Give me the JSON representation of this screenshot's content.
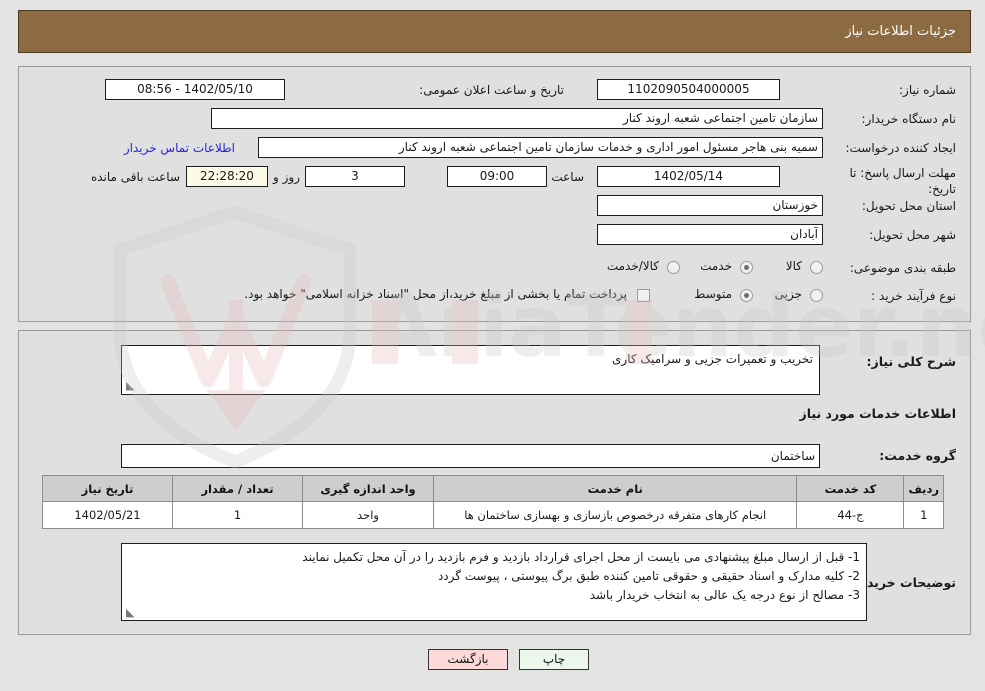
{
  "header": {
    "title": "جزئیات اطلاعات نیاز"
  },
  "form": {
    "need_number_label": "شماره نیاز:",
    "need_number_value": "1102090504000005",
    "announce_label": "تاریخ و ساعت اعلان عمومی:",
    "announce_value": "1402/05/10 - 08:56",
    "buyer_org_label": "نام دستگاه خریدار:",
    "buyer_org_value": "سازمان تامین اجتماعی شعبه اروند کنار",
    "requester_label": "ایجاد کننده درخواست:",
    "requester_value": "سمیه بنی هاجر مسئول امور اداری و خدمات سازمان تامین اجتماعی شعبه اروند کنار",
    "contact_link": "اطلاعات تماس خریدار",
    "deadline_label": "مهلت ارسال پاسخ: تا تاریخ:",
    "deadline_date": "1402/05/14",
    "time_label": "ساعت",
    "time_value": "09:00",
    "days_value": "3",
    "days_unit_label": "روز و",
    "countdown_value": "22:28:20",
    "remaining_label": "ساعت باقی مانده",
    "province_label": "استان محل تحویل:",
    "province_value": "خوزستان",
    "city_label": "شهر محل تحویل:",
    "city_value": "آبادان",
    "category_label": "طبقه بندی موضوعی:",
    "category_options": [
      {
        "label": "کالا",
        "selected": false
      },
      {
        "label": "خدمت",
        "selected": true
      },
      {
        "label": "کالا/خدمت",
        "selected": false
      }
    ],
    "process_label": "نوع فرآیند خرید :",
    "process_options": [
      {
        "label": "جزیی",
        "selected": false
      },
      {
        "label": "متوسط",
        "selected": true
      }
    ],
    "treasury_checkbox_text": "پرداخت تمام یا بخشی از مبلغ خرید،از محل \"اسناد خزانه اسلامی\" خواهد بود.",
    "treasury_checked": false
  },
  "description": {
    "label": "شرح کلی نیاز:",
    "value": "تخریب و تعمیرات جزیی و سرامیک کاری"
  },
  "services_section": {
    "title": "اطلاعات خدمات مورد نیاز",
    "group_label": "گروه خدمت:",
    "group_value": "ساختمان"
  },
  "table": {
    "headers": [
      "ردیف",
      "کد خدمت",
      "نام خدمت",
      "واحد اندازه گیری",
      "تعداد / مقدار",
      "تاریخ نیاز"
    ],
    "rows": [
      {
        "row": "1",
        "code": "ج-44",
        "name": "انجام کارهای متفرقه درخصوص بازسازی و بهسازی ساختمان ها",
        "unit": "واحد",
        "quantity": "1",
        "date": "1402/05/21"
      }
    ]
  },
  "notes": {
    "label": "توضیحات خریدار:",
    "value": "1- قبل از ارسال مبلغ پیشنهادی می بایست از محل اجرای قرارداد بازدید و فرم بازدید را در آن محل تکمیل نمایند\n2- کلیه مدارک و اسناد حقیقی و حقوقی تامین کننده طبق برگ پیوستی ، پیوست گردد\n3- مصالح از نوع درجه یک عالی به انتخاب خریدار باشد"
  },
  "buttons": {
    "print": "چاپ",
    "back": "بازگشت"
  },
  "colors": {
    "header_bar": "#8d6b42",
    "page_bg": "#e3e3e3",
    "panel_bg": "#e0e0e0",
    "link": "#2727d4",
    "table_header": "#cecece",
    "print_btn": "#eaf7ea",
    "back_btn": "#fbd9d9",
    "countdown_bg": "#fbfbe8"
  },
  "watermark": {
    "text": "AriaTender.net"
  }
}
